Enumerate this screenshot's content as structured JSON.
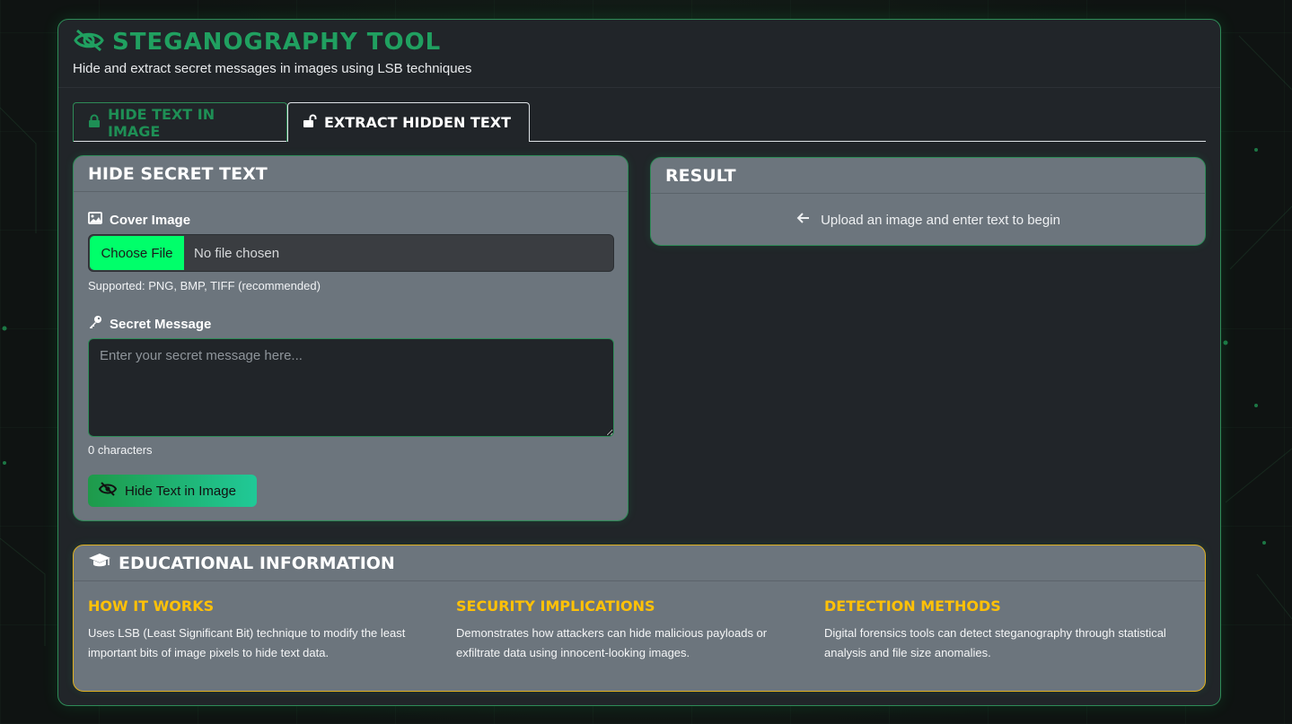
{
  "header": {
    "title": "STEGANOGRAPHY TOOL",
    "subtitle": "Hide and extract secret messages in images using LSB techniques",
    "icon": "eye-slash-icon"
  },
  "tabs": [
    {
      "label": "HIDE TEXT IN IMAGE",
      "icon": "lock-icon",
      "active": false
    },
    {
      "label": "EXTRACT HIDDEN TEXT",
      "icon": "unlock-icon",
      "active": true
    }
  ],
  "hide_card": {
    "title": "HIDE SECRET TEXT",
    "cover_label": "Cover Image",
    "choose_file": "Choose File",
    "file_status": "No file chosen",
    "supported": "Supported: PNG, BMP, TIFF (recommended)",
    "message_label": "Secret Message",
    "message_placeholder": "Enter your secret message here...",
    "char_count": "0 characters",
    "action_label": "Hide Text in Image"
  },
  "result_card": {
    "title": "RESULT",
    "message": "Upload an image and enter text to begin"
  },
  "education": {
    "title": "EDUCATIONAL INFORMATION",
    "columns": [
      {
        "heading": "HOW IT WORKS",
        "text": "Uses LSB (Least Significant Bit) technique to modify the least important bits of image pixels to hide text data."
      },
      {
        "heading": "SECURITY IMPLICATIONS",
        "text": "Demonstrates how attackers can hide malicious payloads or exfiltrate data using innocent-looking images."
      },
      {
        "heading": "DETECTION METHODS",
        "text": "Digital forensics tools can detect steganography through statistical analysis and file size anomalies."
      }
    ]
  },
  "colors": {
    "accent_green": "#20a060",
    "button_green": "#00ff6a",
    "card_bg": "#6c757d",
    "panel_bg": "#212529",
    "edu_accent": "#ffc107"
  }
}
